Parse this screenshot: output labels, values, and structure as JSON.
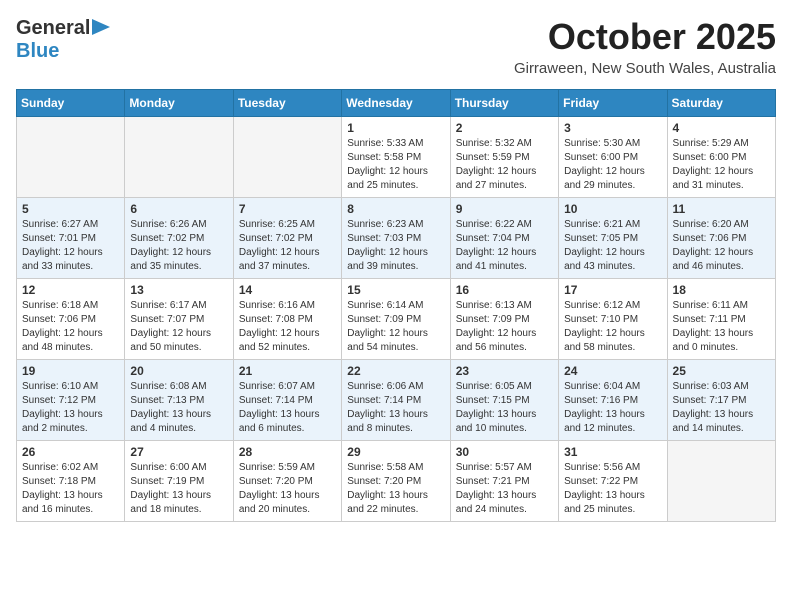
{
  "header": {
    "logo_general": "General",
    "logo_blue": "Blue",
    "month": "October 2025",
    "location": "Girraween, New South Wales, Australia"
  },
  "weekdays": [
    "Sunday",
    "Monday",
    "Tuesday",
    "Wednesday",
    "Thursday",
    "Friday",
    "Saturday"
  ],
  "weeks": [
    [
      {
        "day": "",
        "info": ""
      },
      {
        "day": "",
        "info": ""
      },
      {
        "day": "",
        "info": ""
      },
      {
        "day": "1",
        "info": "Sunrise: 5:33 AM\nSunset: 5:58 PM\nDaylight: 12 hours\nand 25 minutes."
      },
      {
        "day": "2",
        "info": "Sunrise: 5:32 AM\nSunset: 5:59 PM\nDaylight: 12 hours\nand 27 minutes."
      },
      {
        "day": "3",
        "info": "Sunrise: 5:30 AM\nSunset: 6:00 PM\nDaylight: 12 hours\nand 29 minutes."
      },
      {
        "day": "4",
        "info": "Sunrise: 5:29 AM\nSunset: 6:00 PM\nDaylight: 12 hours\nand 31 minutes."
      }
    ],
    [
      {
        "day": "5",
        "info": "Sunrise: 6:27 AM\nSunset: 7:01 PM\nDaylight: 12 hours\nand 33 minutes."
      },
      {
        "day": "6",
        "info": "Sunrise: 6:26 AM\nSunset: 7:02 PM\nDaylight: 12 hours\nand 35 minutes."
      },
      {
        "day": "7",
        "info": "Sunrise: 6:25 AM\nSunset: 7:02 PM\nDaylight: 12 hours\nand 37 minutes."
      },
      {
        "day": "8",
        "info": "Sunrise: 6:23 AM\nSunset: 7:03 PM\nDaylight: 12 hours\nand 39 minutes."
      },
      {
        "day": "9",
        "info": "Sunrise: 6:22 AM\nSunset: 7:04 PM\nDaylight: 12 hours\nand 41 minutes."
      },
      {
        "day": "10",
        "info": "Sunrise: 6:21 AM\nSunset: 7:05 PM\nDaylight: 12 hours\nand 43 minutes."
      },
      {
        "day": "11",
        "info": "Sunrise: 6:20 AM\nSunset: 7:06 PM\nDaylight: 12 hours\nand 46 minutes."
      }
    ],
    [
      {
        "day": "12",
        "info": "Sunrise: 6:18 AM\nSunset: 7:06 PM\nDaylight: 12 hours\nand 48 minutes."
      },
      {
        "day": "13",
        "info": "Sunrise: 6:17 AM\nSunset: 7:07 PM\nDaylight: 12 hours\nand 50 minutes."
      },
      {
        "day": "14",
        "info": "Sunrise: 6:16 AM\nSunset: 7:08 PM\nDaylight: 12 hours\nand 52 minutes."
      },
      {
        "day": "15",
        "info": "Sunrise: 6:14 AM\nSunset: 7:09 PM\nDaylight: 12 hours\nand 54 minutes."
      },
      {
        "day": "16",
        "info": "Sunrise: 6:13 AM\nSunset: 7:09 PM\nDaylight: 12 hours\nand 56 minutes."
      },
      {
        "day": "17",
        "info": "Sunrise: 6:12 AM\nSunset: 7:10 PM\nDaylight: 12 hours\nand 58 minutes."
      },
      {
        "day": "18",
        "info": "Sunrise: 6:11 AM\nSunset: 7:11 PM\nDaylight: 13 hours\nand 0 minutes."
      }
    ],
    [
      {
        "day": "19",
        "info": "Sunrise: 6:10 AM\nSunset: 7:12 PM\nDaylight: 13 hours\nand 2 minutes."
      },
      {
        "day": "20",
        "info": "Sunrise: 6:08 AM\nSunset: 7:13 PM\nDaylight: 13 hours\nand 4 minutes."
      },
      {
        "day": "21",
        "info": "Sunrise: 6:07 AM\nSunset: 7:14 PM\nDaylight: 13 hours\nand 6 minutes."
      },
      {
        "day": "22",
        "info": "Sunrise: 6:06 AM\nSunset: 7:14 PM\nDaylight: 13 hours\nand 8 minutes."
      },
      {
        "day": "23",
        "info": "Sunrise: 6:05 AM\nSunset: 7:15 PM\nDaylight: 13 hours\nand 10 minutes."
      },
      {
        "day": "24",
        "info": "Sunrise: 6:04 AM\nSunset: 7:16 PM\nDaylight: 13 hours\nand 12 minutes."
      },
      {
        "day": "25",
        "info": "Sunrise: 6:03 AM\nSunset: 7:17 PM\nDaylight: 13 hours\nand 14 minutes."
      }
    ],
    [
      {
        "day": "26",
        "info": "Sunrise: 6:02 AM\nSunset: 7:18 PM\nDaylight: 13 hours\nand 16 minutes."
      },
      {
        "day": "27",
        "info": "Sunrise: 6:00 AM\nSunset: 7:19 PM\nDaylight: 13 hours\nand 18 minutes."
      },
      {
        "day": "28",
        "info": "Sunrise: 5:59 AM\nSunset: 7:20 PM\nDaylight: 13 hours\nand 20 minutes."
      },
      {
        "day": "29",
        "info": "Sunrise: 5:58 AM\nSunset: 7:20 PM\nDaylight: 13 hours\nand 22 minutes."
      },
      {
        "day": "30",
        "info": "Sunrise: 5:57 AM\nSunset: 7:21 PM\nDaylight: 13 hours\nand 24 minutes."
      },
      {
        "day": "31",
        "info": "Sunrise: 5:56 AM\nSunset: 7:22 PM\nDaylight: 13 hours\nand 25 minutes."
      },
      {
        "day": "",
        "info": ""
      }
    ]
  ]
}
